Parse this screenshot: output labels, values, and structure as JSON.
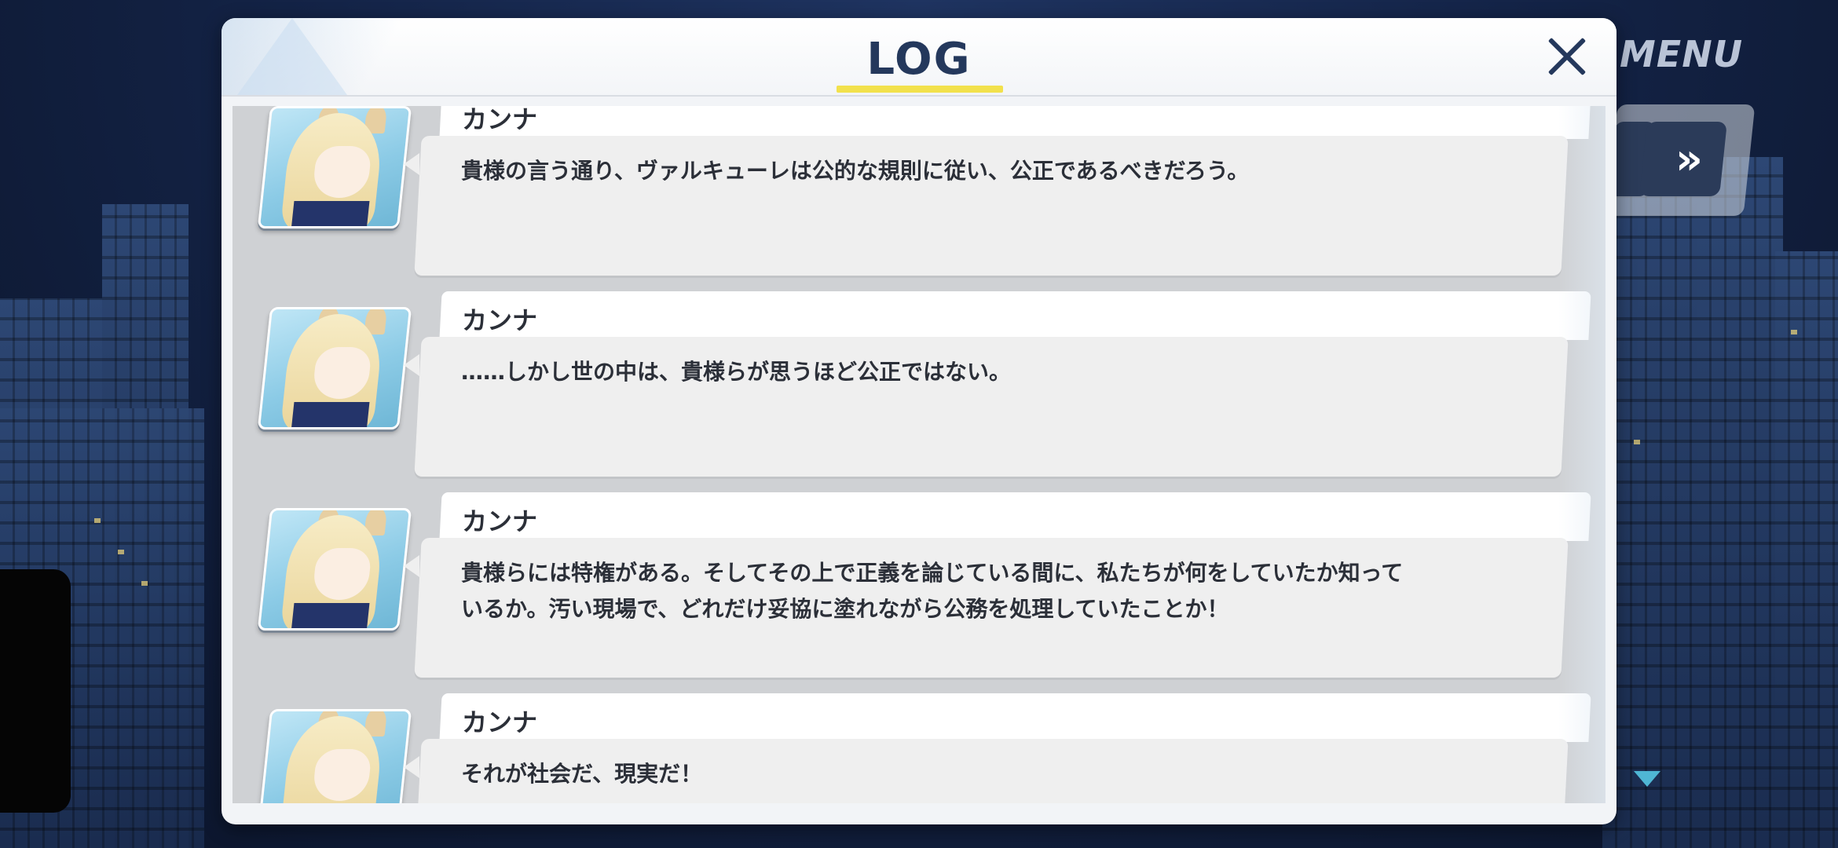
{
  "hud": {
    "menu_label": "MENU",
    "fast_forward_glyph": "»"
  },
  "log": {
    "title": "LOG",
    "close_glyph": "",
    "entries": [
      {
        "speaker": "カンナ",
        "text": "貴様の言う通り、ヴァルキューレは公的な規則に従い、公正であるべきだろう。"
      },
      {
        "speaker": "カンナ",
        "text": "……しかし世の中は、貴様らが思うほど公正ではない。"
      },
      {
        "speaker": "カンナ",
        "text": "貴様らには特権がある。そしてその上で正義を論じている間に、私たちが何をしていたか知っているか。汚い現場で、どれだけ妥協に塗れながら公務を処理していたことか！"
      },
      {
        "speaker": "カンナ",
        "text": "それが社会だ、現実だ！"
      }
    ]
  },
  "colors": {
    "title": "#24385c",
    "underline": "#f2e14c",
    "scroll_arrow": "#4fb6d4"
  }
}
